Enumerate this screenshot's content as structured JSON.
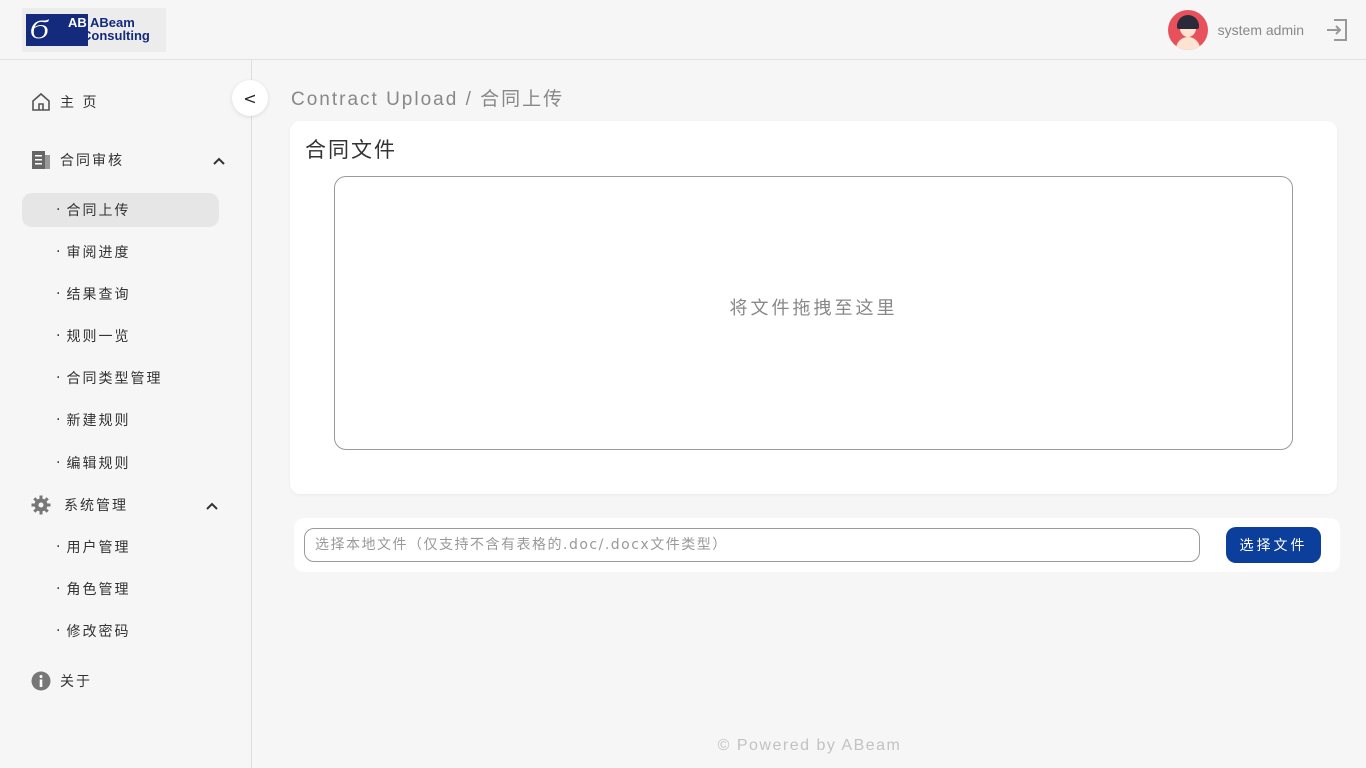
{
  "header": {
    "logo": {
      "brand_line1": "ABeam",
      "brand_line2": "Consulting",
      "mark": "AB"
    },
    "user_name": "system admin",
    "logout_icon": "logout-icon"
  },
  "sidebar": {
    "collapse_label": "<",
    "home": {
      "label": "主 页",
      "icon": "home-icon"
    },
    "groups": [
      {
        "label": "合同审核",
        "icon": "document-list-icon",
        "expanded": true,
        "items": [
          {
            "label": "合同上传",
            "active": true
          },
          {
            "label": "审阅进度"
          },
          {
            "label": "结果查询"
          },
          {
            "label": "规则一览"
          },
          {
            "label": "合同类型管理"
          },
          {
            "label": "新建规则"
          },
          {
            "label": "编辑规则"
          }
        ]
      },
      {
        "label": "系统管理",
        "icon": "gear-icon",
        "expanded": true,
        "items": [
          {
            "label": "用户管理"
          },
          {
            "label": "角色管理"
          },
          {
            "label": "修改密码"
          }
        ]
      }
    ],
    "about": {
      "label": "关于",
      "icon": "info-icon"
    }
  },
  "main": {
    "breadcrumb": "Contract Upload / 合同上传",
    "card_title": "合同文件",
    "drop_text": "将文件拖拽至这里",
    "file_input_placeholder": "选择本地文件（仅支持不含有表格的.doc/.docx文件类型）",
    "choose_button": "选择文件"
  },
  "footer": "© Powered by ABeam",
  "colors": {
    "primary": "#0b3f9b",
    "background": "#f6f6f6",
    "avatar": "#e8505b"
  }
}
